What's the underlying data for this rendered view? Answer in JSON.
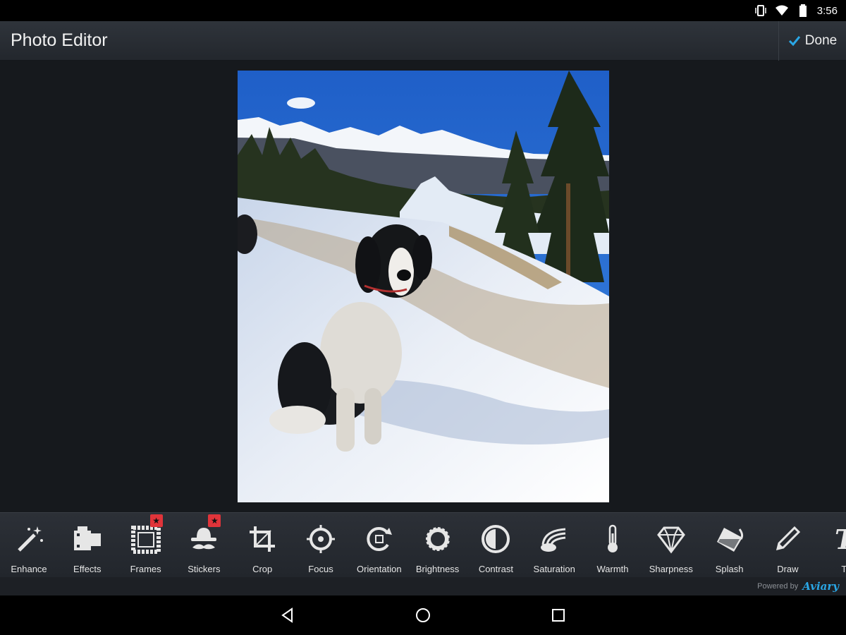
{
  "status_bar": {
    "time": "3:56"
  },
  "app_bar": {
    "title": "Photo Editor",
    "done_label": "Done"
  },
  "toolbar": {
    "tools": [
      {
        "label": "Enhance",
        "icon": "magic-wand-icon",
        "badge": false
      },
      {
        "label": "Effects",
        "icon": "film-icon",
        "badge": false
      },
      {
        "label": "Frames",
        "icon": "frame-icon",
        "badge": true
      },
      {
        "label": "Stickers",
        "icon": "hat-mustache-icon",
        "badge": true
      },
      {
        "label": "Crop",
        "icon": "crop-icon",
        "badge": false
      },
      {
        "label": "Focus",
        "icon": "crosshair-icon",
        "badge": false
      },
      {
        "label": "Orientation",
        "icon": "rotate-icon",
        "badge": false
      },
      {
        "label": "Brightness",
        "icon": "sun-icon",
        "badge": false
      },
      {
        "label": "Contrast",
        "icon": "contrast-icon",
        "badge": false
      },
      {
        "label": "Saturation",
        "icon": "rainbow-icon",
        "badge": false
      },
      {
        "label": "Warmth",
        "icon": "thermometer-icon",
        "badge": false
      },
      {
        "label": "Sharpness",
        "icon": "diamond-icon",
        "badge": false
      },
      {
        "label": "Splash",
        "icon": "paint-bucket-icon",
        "badge": false
      },
      {
        "label": "Draw",
        "icon": "pencil-icon",
        "badge": false
      },
      {
        "label": "Te",
        "icon": "text-icon",
        "badge": false
      }
    ],
    "badge_glyph": "★",
    "powered_by": "Powered by",
    "powered_brand": "Aviary"
  },
  "colors": {
    "accent": "#2aa7e6",
    "badge": "#e0343a",
    "toolbar_bg": "#2c3037",
    "canvas_bg": "#16191d"
  }
}
